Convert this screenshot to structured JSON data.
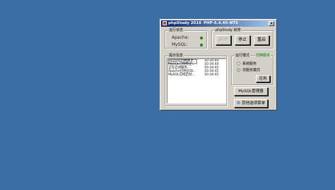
{
  "window": {
    "title": "phpStudy 2016",
    "version": "PHP-5.4.45-NTS",
    "close_glyph": "×"
  },
  "status": {
    "group_label": "运行状态",
    "apache_label": "Apache:",
    "mysql_label": "MySQL:",
    "dot_color": "#0a8a0a"
  },
  "control": {
    "group_label": "phpStudy 启停",
    "start_label": "启动",
    "stop_label": "停止",
    "restart_label": "重启"
  },
  "log": {
    "group_label": "提示信息",
    "rows": [
      {
        "msg": "Apache已经停止...",
        "time": "10:34:44"
      },
      {
        "msg": "MySQL已经停止...",
        "time": "10:34:44"
      },
      {
        "msg": "正在启动服务...",
        "time": "10:34:45"
      },
      {
        "msg": "Apache已经启动...",
        "time": "10:34:45"
      },
      {
        "msg": "MySQL已经启动...",
        "time": "10:34:45"
      }
    ]
  },
  "mode": {
    "group_label": "运行模式",
    "switch_label": "切换版本",
    "option_system": "系统服务",
    "option_nonservice": "非服务模式",
    "apply_label": "应用"
  },
  "buttons": {
    "mysql_manager": "MySQL管理器",
    "other_menu": "其他选项菜单"
  }
}
